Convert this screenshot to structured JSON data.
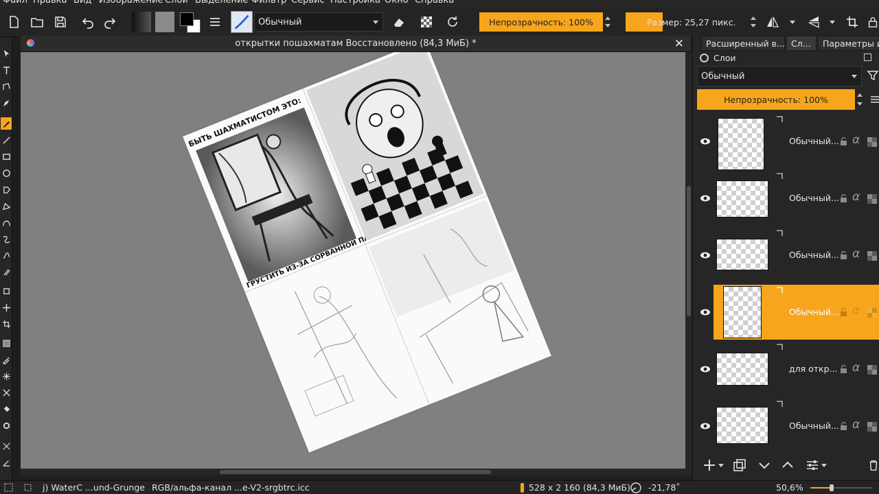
{
  "menu": [
    "Файл",
    "Правка",
    "Вид",
    "Изображение",
    "Слои",
    "Выделение",
    "Фильтр",
    "Сервис",
    "Настройка",
    "Окно",
    "Справка"
  ],
  "toolbar": {
    "blend_mode": "Обычный",
    "opacity_label": "Непрозрачность: 100%",
    "size_label": "Размер: 25,27 пикс.",
    "colors": {
      "foreground": "#000000",
      "background": "#ffffff",
      "accent": "#f7a51c"
    }
  },
  "document": {
    "title": "открытки пошахматам Восстановлено  (84,3 МиБ)  *",
    "close_glyph": "✕",
    "page_captions": {
      "top": "БЫТЬ ШАХМАТИСТОМ ЭТО:",
      "bottom": "ГРУСТИТЬ ИЗ-ЗА СОРВАННОЙ ПАРТИИ"
    }
  },
  "right_panel": {
    "tabs": [
      "Расширенный в...",
      "Сл...",
      "Параметры ин..."
    ],
    "layers_title": "Слои",
    "blend_mode": "Обычный",
    "opacity_label": "Непрозрачность:  100%",
    "layers": [
      {
        "name": "Обычный...",
        "selected": false
      },
      {
        "name": "Обычный...",
        "selected": false
      },
      {
        "name": "Обычный...",
        "selected": false
      },
      {
        "name": "Обычный...",
        "selected": true
      },
      {
        "name": "для откр...",
        "selected": false
      },
      {
        "name": "Обычный...",
        "selected": false
      }
    ]
  },
  "status": {
    "brush": "j) WaterC ...und-Grunge",
    "color_profile": "RGB/альфа-канал ...e-V2-srgbtrc.icc",
    "image_size": "528 x 2 160 (84,3 МиБ)",
    "rotation": "-21,78˚",
    "zoom": "50,6%"
  }
}
